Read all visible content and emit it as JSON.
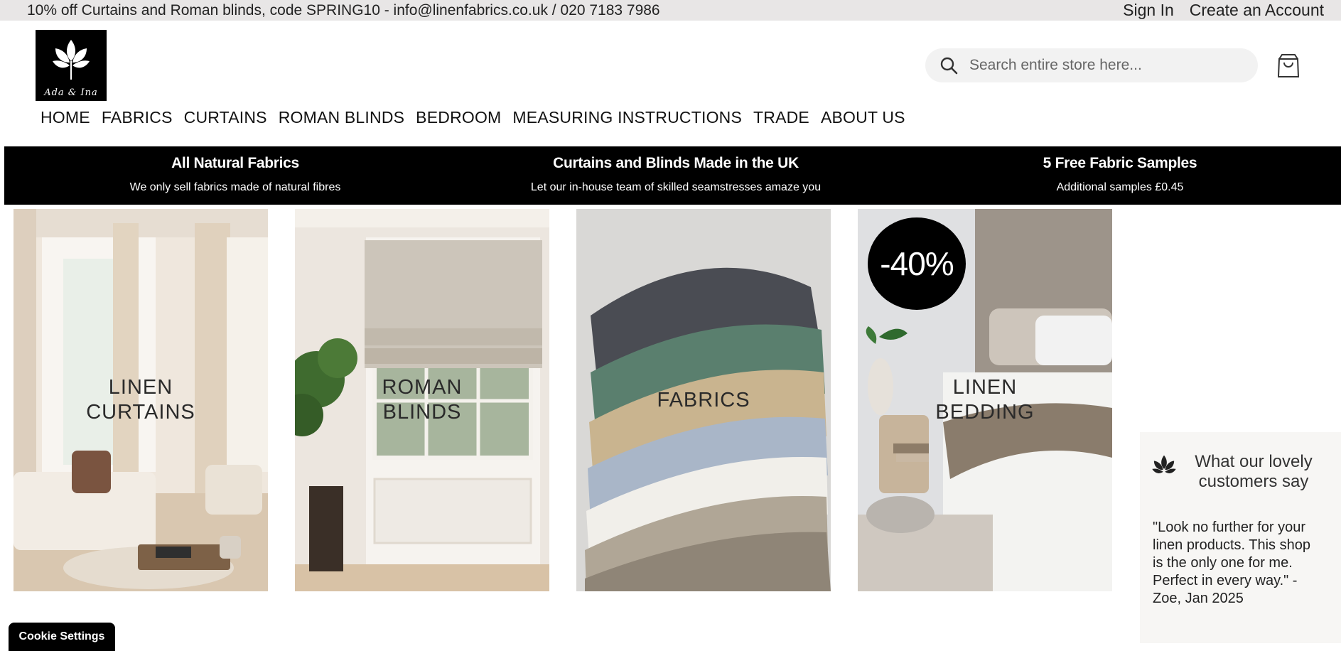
{
  "topbar": {
    "promo": "10% off Curtains and Roman blinds, code SPRING10 - info@linenfabrics.co.uk / 020 7183 7986",
    "sign_in": "Sign In",
    "create_account": "Create an Account"
  },
  "logo": {
    "script_text": "Ada & Ina"
  },
  "search": {
    "placeholder": "Search entire store here..."
  },
  "nav": {
    "items": [
      "HOME",
      "FABRICS",
      "CURTAINS",
      "ROMAN BLINDS",
      "BEDROOM",
      "MEASURING INSTRUCTIONS",
      "TRADE",
      "ABOUT US"
    ]
  },
  "usp": [
    {
      "title": "All Natural Fabrics",
      "subtitle": "We only sell fabrics made of natural fibres"
    },
    {
      "title": "Curtains and Blinds Made in the UK",
      "subtitle": "Let our in-house team of skilled seamstresses amaze you"
    },
    {
      "title": "5 Free Fabric Samples",
      "subtitle": "Additional samples £0.45"
    }
  ],
  "tiles": [
    {
      "line1": "LINEN",
      "line2": "CURTAINS"
    },
    {
      "line1": "ROMAN",
      "line2": "BLINDS"
    },
    {
      "line1": "FABRICS",
      "line2": ""
    },
    {
      "line1": "LINEN",
      "line2": "BEDDING",
      "badge": "-40%"
    }
  ],
  "reviews": {
    "title": "What our lovely customers say",
    "quote": "\"Look no further for your linen products. This shop is the only one for me. Perfect in every way.\" - Zoe, Jan 2025"
  },
  "cookie": {
    "label": "Cookie Settings"
  },
  "colors": {
    "dark": "#000000",
    "promo_bg": "#e8e6e6",
    "search_bg": "#f2f2f2"
  }
}
